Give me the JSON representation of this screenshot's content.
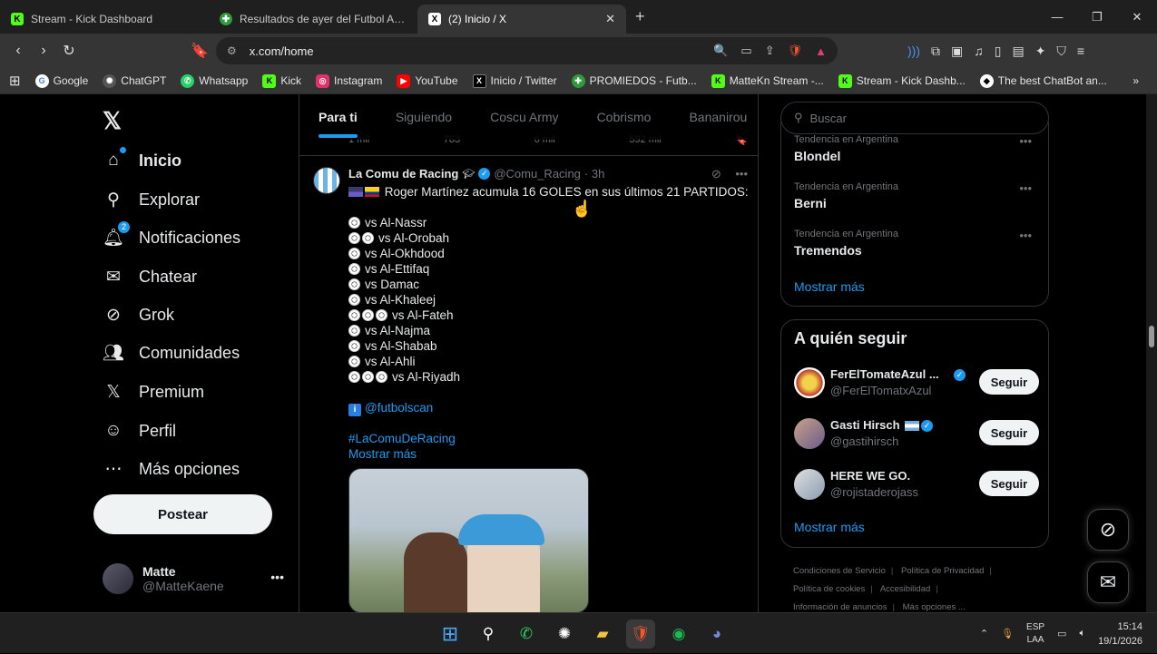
{
  "browser": {
    "tabs": [
      {
        "title": "Stream - Kick Dashboard",
        "icon": "kick-icon",
        "active": false
      },
      {
        "title": "Resultados de ayer del Futbol Argentino",
        "icon": "promiedos-icon",
        "active": false
      },
      {
        "title": "(2) Inicio / X",
        "icon": "x-icon",
        "active": true
      }
    ],
    "url": "x.com/home",
    "bookmarks": [
      {
        "label": "Google",
        "color": "#ea4335"
      },
      {
        "label": "ChatGPT",
        "color": "#555555"
      },
      {
        "label": "Whatsapp",
        "color": "#25d366"
      },
      {
        "label": "Kick",
        "color": "#53fc18"
      },
      {
        "label": "Instagram",
        "color": "#e1306c"
      },
      {
        "label": "YouTube",
        "color": "#ff0000"
      },
      {
        "label": "Inicio / Twitter",
        "color": "#000000"
      },
      {
        "label": "PROMIEDOS - Futb...",
        "color": "#2e9c3a"
      },
      {
        "label": "MatteKn Stream -...",
        "color": "#53fc18"
      },
      {
        "label": "Stream - Kick Dashb...",
        "color": "#53fc18"
      },
      {
        "label": "The best ChatBot an...",
        "color": "#ffffff"
      }
    ]
  },
  "nav": {
    "items": [
      {
        "label": "Inicio",
        "icon": "home-icon"
      },
      {
        "label": "Explorar",
        "icon": "search-icon"
      },
      {
        "label": "Notificaciones",
        "icon": "bell-icon",
        "badge": "2"
      },
      {
        "label": "Chatear",
        "icon": "mail-icon"
      },
      {
        "label": "Grok",
        "icon": "grok-icon"
      },
      {
        "label": "Comunidades",
        "icon": "communities-icon"
      },
      {
        "label": "Premium",
        "icon": "x-icon"
      },
      {
        "label": "Perfil",
        "icon": "person-icon"
      },
      {
        "label": "Más opciones",
        "icon": "more-circle-icon"
      }
    ],
    "post_label": "Postear",
    "profile": {
      "name": "Matte",
      "handle": "@MatteKaene"
    }
  },
  "feed": {
    "tabs": [
      "Para ti",
      "Siguiendo",
      "Coscu Army",
      "Cobrismo",
      "Bananirou"
    ],
    "prev_actions": [
      "1 mil",
      "783",
      "6 mil",
      "592 mil"
    ],
    "tweet": {
      "name": "La Comu de Racing",
      "handle": "@Comu_Racing",
      "time": "· 3h",
      "headline": "Roger Martínez acumula 16 GOLES en sus últimos 21 PARTIDOS:",
      "lines": [
        {
          "balls": 1,
          "text": "vs Al-Nassr"
        },
        {
          "balls": 2,
          "text": "vs Al-Orobah"
        },
        {
          "balls": 1,
          "text": "vs Al-Okhdood"
        },
        {
          "balls": 1,
          "text": "vs Al-Ettifaq"
        },
        {
          "balls": 1,
          "text": "vs Damac"
        },
        {
          "balls": 1,
          "text": "vs Al-Khaleej"
        },
        {
          "balls": 3,
          "text": "vs Al-Fateh"
        },
        {
          "balls": 1,
          "text": "vs Al-Najma"
        },
        {
          "balls": 1,
          "text": "vs Al-Shabab"
        },
        {
          "balls": 1,
          "text": "vs Al-Ahli"
        },
        {
          "balls": 3,
          "text": "vs Al-Riyadh"
        }
      ],
      "source": "@futbolscan",
      "hashtag": "#LaComuDeRacing",
      "show_more": "Mostrar más"
    }
  },
  "sidebar": {
    "search_placeholder": "Buscar",
    "trends": [
      {
        "category": "Tendencia en Argentina",
        "title": "Blondel"
      },
      {
        "category": "Tendencia en Argentina",
        "title": "Berni"
      },
      {
        "category": "Tendencia en Argentina",
        "title": "Tremendos"
      }
    ],
    "trends_more": "Mostrar más",
    "who_to_follow_title": "A quién seguir",
    "follow_suggestions": [
      {
        "name": "FerElTomateAzul ...",
        "handle": "@FerElTomatxAzul",
        "verified": true
      },
      {
        "name": "Gasti Hirsch",
        "handle": "@gastihirsch",
        "verified": true
      },
      {
        "name": "HERE WE GO.",
        "handle": "@rojistaderojass",
        "verified": false
      }
    ],
    "follow_label": "Seguir",
    "follow_more": "Mostrar más",
    "footer_links": [
      "Condiciones de Servicio",
      "Política de Privacidad",
      "Política de cookies",
      "Accesibilidad",
      "Información de anuncios",
      "Más opciones ..."
    ]
  },
  "taskbar": {
    "lang": "ESP",
    "lang2": "LAA",
    "time": "15:14",
    "date": "19/1/2026"
  }
}
